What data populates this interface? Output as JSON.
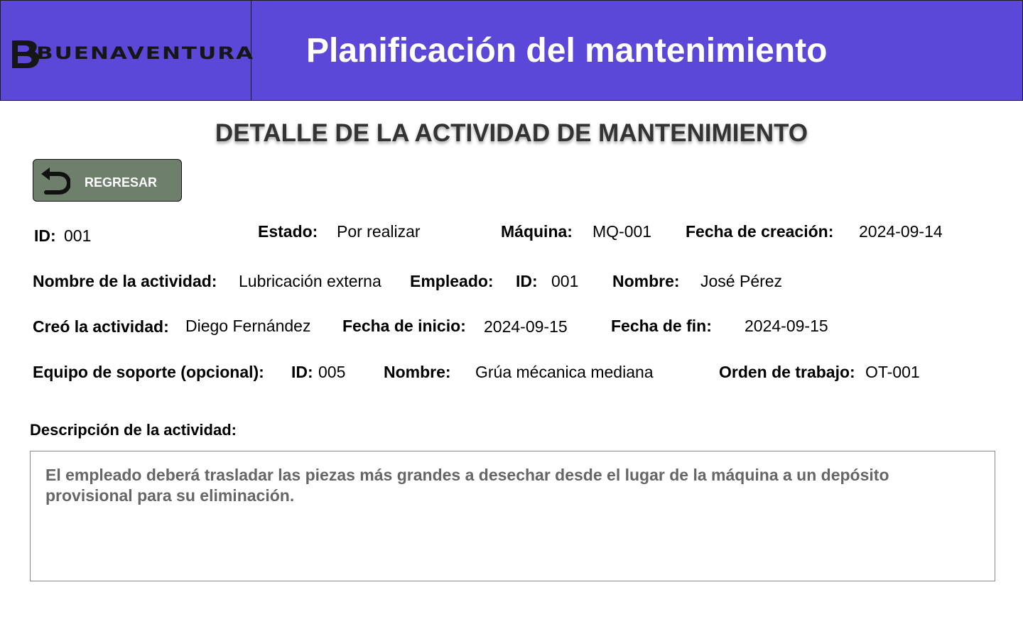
{
  "header": {
    "logo_text": "BUENAVENTURA",
    "title": "Planificación del mantenimiento",
    "background_color": "#5b47d8"
  },
  "page": {
    "title": "DETALLE DE LA ACTIVIDAD DE MANTENIMIENTO"
  },
  "back_button": {
    "label": "REGRESAR",
    "icon": "undo-arrow-icon",
    "color": "#6e7f6c"
  },
  "fields": {
    "id": {
      "label": "ID:",
      "value": "001"
    },
    "estado": {
      "label": "Estado:",
      "value": "Por realizar"
    },
    "maquina": {
      "label": "Máquina:",
      "value": "MQ-001"
    },
    "fecha_creacion": {
      "label": "Fecha de creación:",
      "value": "2024-09-14"
    },
    "nombre_actividad": {
      "label": "Nombre de la actividad:",
      "value": "Lubricación externa"
    },
    "empleado": {
      "label": "Empleado:",
      "id_label": "ID:",
      "id_value": "001",
      "nombre_label": "Nombre:",
      "nombre_value": "José Pérez"
    },
    "creo_actividad": {
      "label": "Creó la actividad:",
      "value": "Diego Fernández"
    },
    "fecha_inicio": {
      "label": "Fecha de inicio:",
      "value": "2024-09-15"
    },
    "fecha_fin": {
      "label": "Fecha de fin:",
      "value": "2024-09-15"
    },
    "equipo_soporte": {
      "label": "Equipo de soporte (opcional):",
      "id_label": "ID:",
      "id_value": "005",
      "nombre_label": "Nombre:",
      "nombre_value": "Grúa mécanica mediana"
    },
    "orden_trabajo": {
      "label": "Orden de trabajo:",
      "value": "OT-001"
    }
  },
  "description": {
    "label": "Descripción de la actividad:",
    "text": "El empleado deberá trasladar las piezas más grandes a desechar desde el lugar de la máquina a un depósito provisional para su eliminación."
  }
}
